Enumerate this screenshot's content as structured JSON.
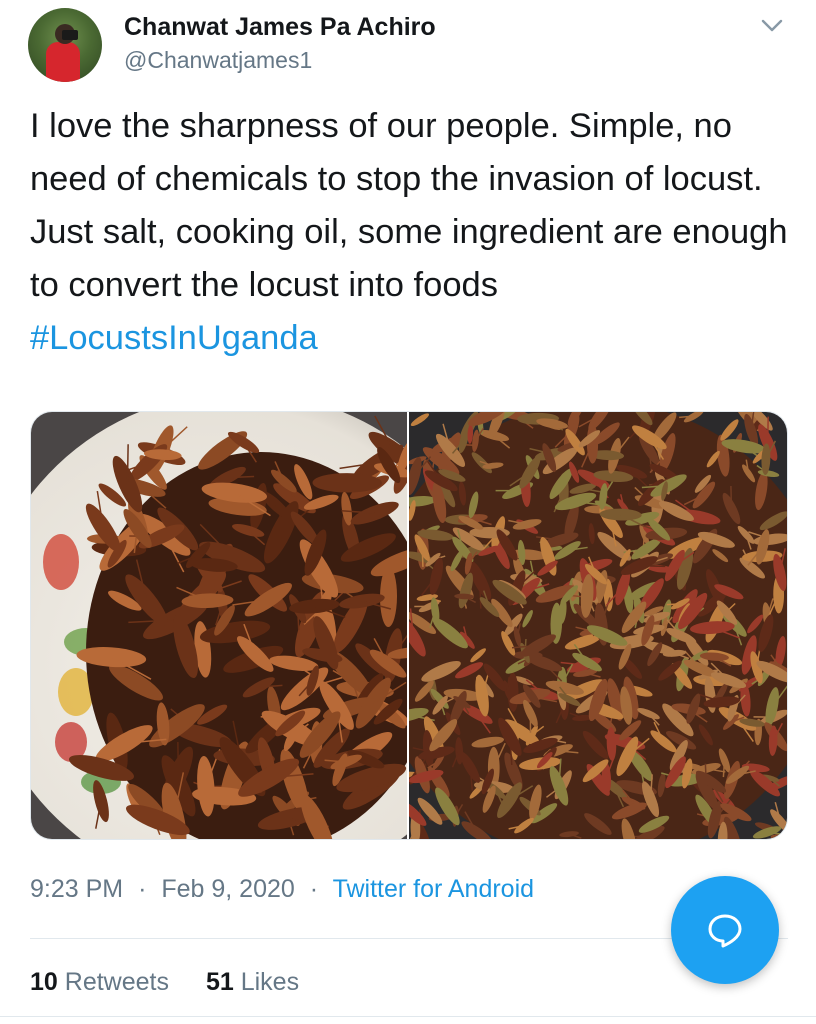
{
  "tweet": {
    "author_name": "Chanwat James Pa Achiro",
    "author_handle": "@Chanwatjames1",
    "text": "I love the sharpness of our people. Simple, no need of chemicals to stop the invasion of locust. Just salt, cooking oil, some ingredient are enough to convert the locust into foods ",
    "hashtag": "#LocustsInUganda",
    "time": "9:23 PM",
    "date": "Feb 9, 2020",
    "meta_separator": "·",
    "source": "Twitter for Android",
    "retweets_count": "10",
    "retweets_label": "Retweets",
    "likes_count": "51",
    "likes_label": "Likes"
  },
  "colors": {
    "link": "#1b95e0",
    "secondary_text": "#657786",
    "fab": "#1da1f2"
  },
  "icons": {
    "menu": "chevron-down-icon",
    "fab": "reply-bubble-icon"
  }
}
